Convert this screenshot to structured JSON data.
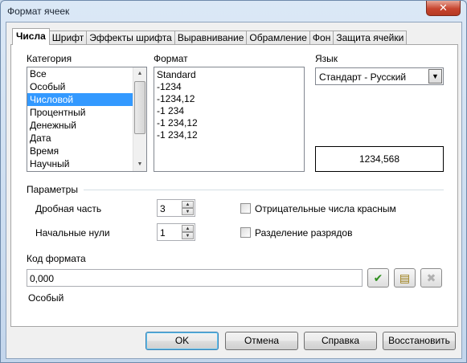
{
  "window": {
    "title": "Формат ячеек",
    "close_label": "✕"
  },
  "tabs": [
    {
      "label": "Числа"
    },
    {
      "label": "Шрифт"
    },
    {
      "label": "Эффекты шрифта"
    },
    {
      "label": "Выравнивание"
    },
    {
      "label": "Обрамление"
    },
    {
      "label": "Фон"
    },
    {
      "label": "Защита ячейки"
    }
  ],
  "category": {
    "label": "Категория",
    "items": [
      "Все",
      "Особый",
      "Числовой",
      "Процентный",
      "Денежный",
      "Дата",
      "Время",
      "Научный"
    ],
    "selected_index": 2
  },
  "format": {
    "label": "Формат",
    "items": [
      "Standard",
      "-1234",
      "-1234,12",
      "-1 234",
      "-1 234,12",
      "-1 234,12"
    ]
  },
  "language": {
    "label": "Язык",
    "value": "Стандарт - Русский"
  },
  "preview": {
    "value": "1234,568"
  },
  "options": {
    "label": "Параметры",
    "decimal_places_label": "Дробная часть",
    "decimal_places_value": "3",
    "leading_zeros_label": "Начальные нули",
    "leading_zeros_value": "1",
    "negative_red_label": "Отрицательные числа красным",
    "negative_red_checked": false,
    "thousands_sep_label": "Разделение разрядов",
    "thousands_sep_checked": false
  },
  "format_code": {
    "label": "Код формата",
    "value": "0,000"
  },
  "status_text": "Особый",
  "buttons": {
    "ok": "OK",
    "cancel": "Отмена",
    "help": "Справка",
    "reset": "Восстановить"
  }
}
